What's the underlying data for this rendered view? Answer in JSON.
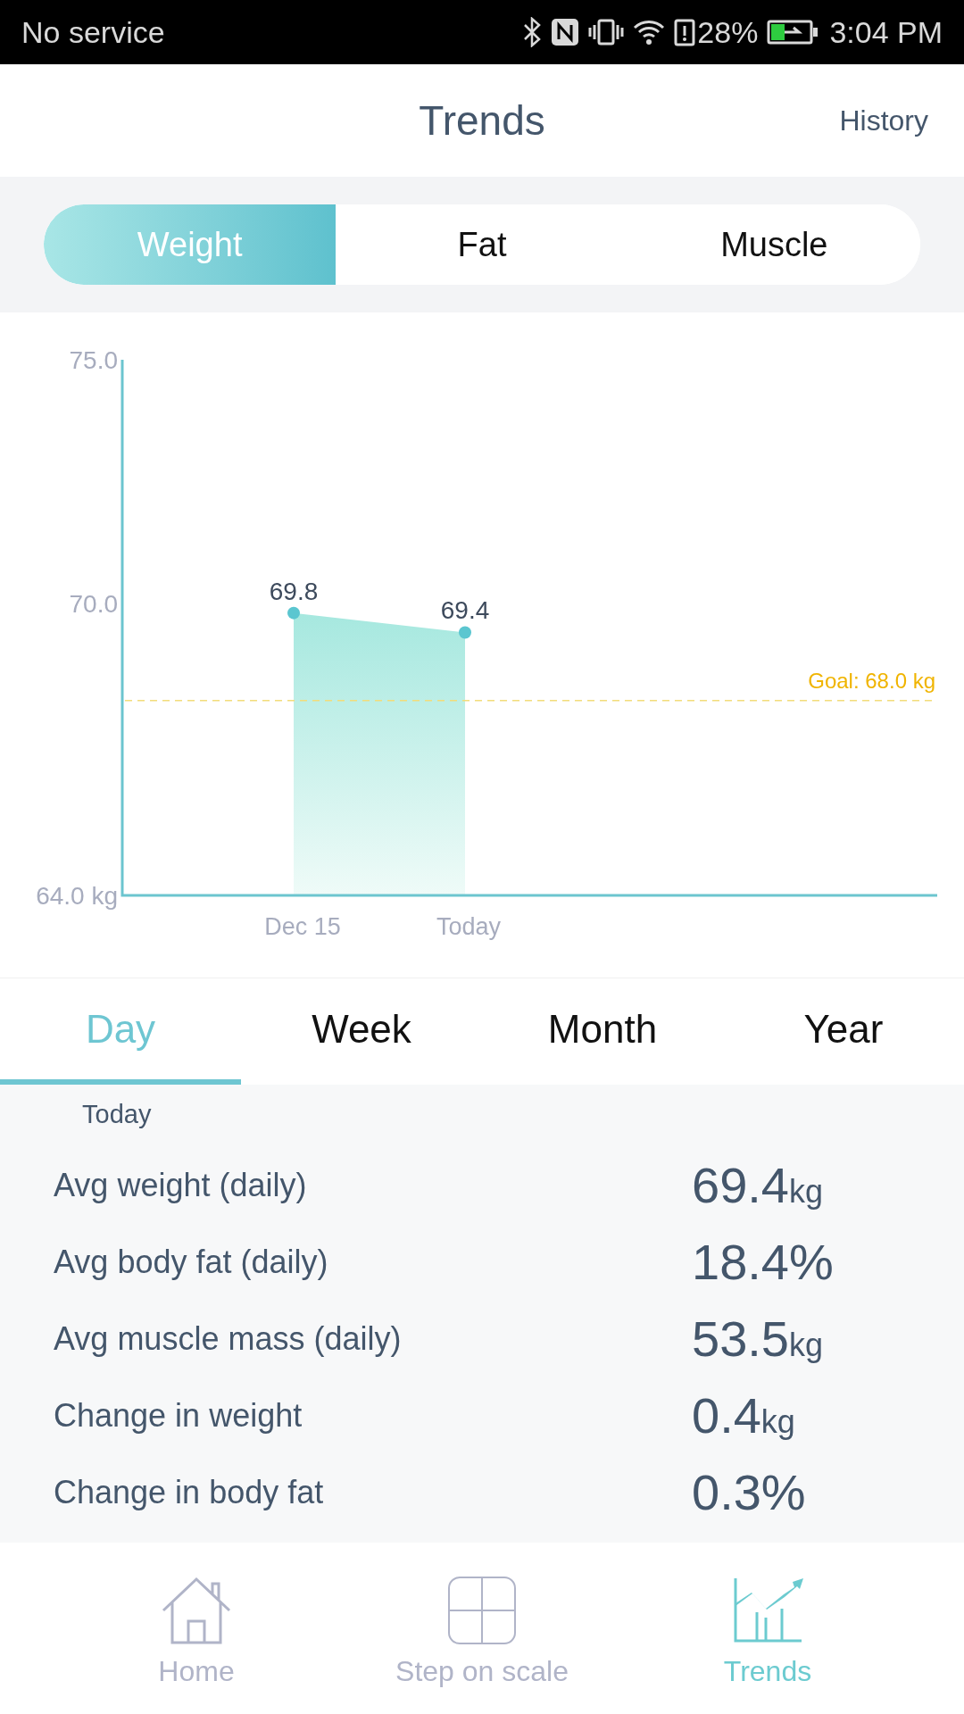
{
  "status_bar": {
    "carrier": "No service",
    "battery_percent": "28%",
    "time": "3:04 PM"
  },
  "header": {
    "title": "Trends",
    "action": "History"
  },
  "metric_tabs": [
    {
      "label": "Weight",
      "selected": true
    },
    {
      "label": "Fat",
      "selected": false
    },
    {
      "label": "Muscle",
      "selected": false
    }
  ],
  "chart": {
    "chart_data": {
      "type": "area",
      "categories": [
        "Dec 15",
        "Today"
      ],
      "series": [
        {
          "color": "#5bc6d0",
          "values": [
            69.8,
            69.4
          ]
        }
      ],
      "ylim": [
        64,
        75
      ],
      "yticks": [
        {
          "value": 64,
          "label": "64.0 kg"
        },
        {
          "value": 70,
          "label": "70.0"
        },
        {
          "value": 75,
          "label": "75.0"
        }
      ],
      "data_labels": true,
      "ref_lines": [
        {
          "axis": "y",
          "value": 68,
          "label": "Goal: 68.0 kg"
        }
      ]
    }
  },
  "period_tabs": [
    {
      "label": "Day",
      "selected": true
    },
    {
      "label": "Week",
      "selected": false
    },
    {
      "label": "Month",
      "selected": false
    },
    {
      "label": "Year",
      "selected": false
    }
  ],
  "stats": {
    "period": "Today",
    "rows": [
      {
        "label": "Avg weight (daily)",
        "value": "69.4",
        "unit": "kg"
      },
      {
        "label": "Avg body fat (daily)",
        "value": "18.4%"
      },
      {
        "label": "Avg muscle mass (daily)",
        "value": "53.5",
        "unit": "kg"
      },
      {
        "label": "Change in weight",
        "value": "0.4",
        "unit": "kg"
      },
      {
        "label": "Change in body fat",
        "value": "0.3%"
      }
    ]
  },
  "bottom_nav": [
    {
      "kind": "home",
      "label": "Home",
      "selected": false
    },
    {
      "kind": "scale",
      "label": "Step on scale",
      "selected": false
    },
    {
      "kind": "trends",
      "label": "Trends",
      "selected": true
    }
  ]
}
